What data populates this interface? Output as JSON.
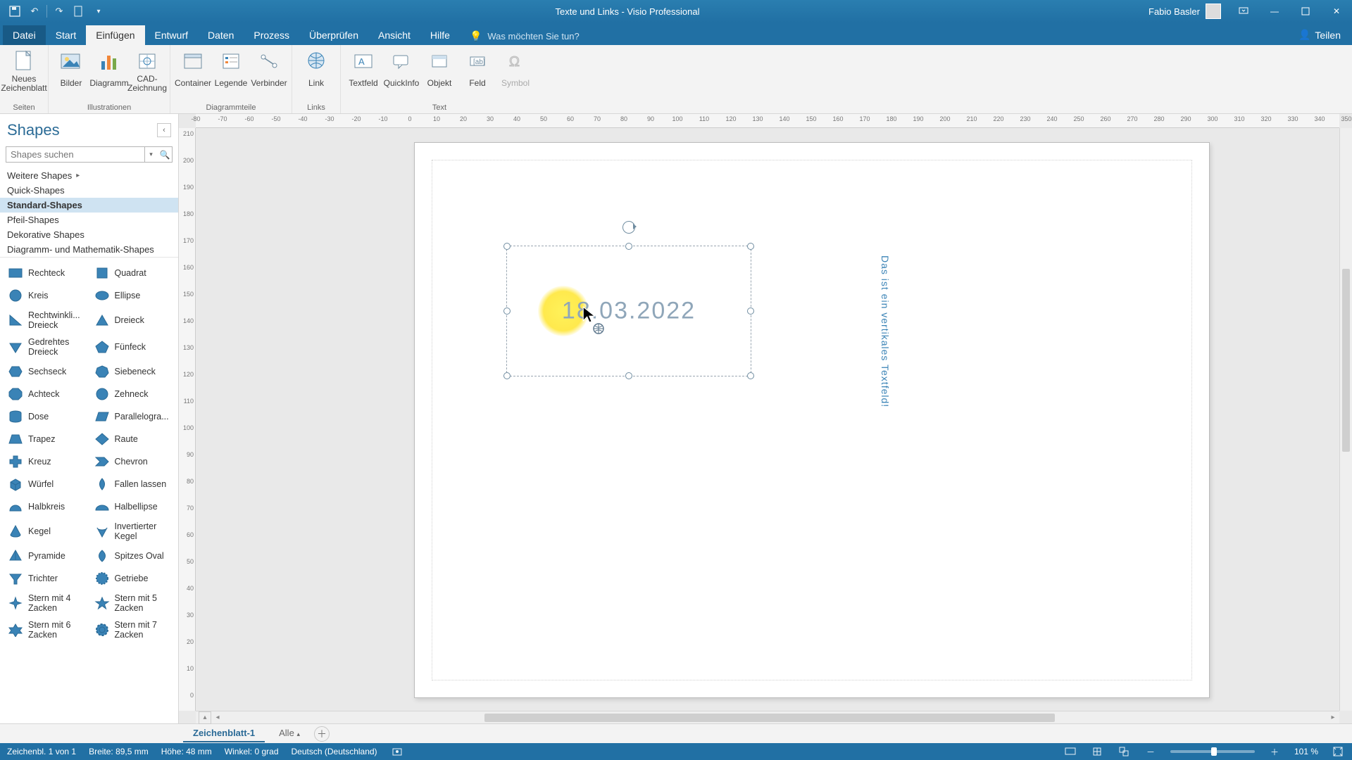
{
  "titlebar": {
    "title": "Texte und Links  -  Visio Professional",
    "user": "Fabio Basler"
  },
  "menu": {
    "tabs": [
      "Datei",
      "Start",
      "Einfügen",
      "Entwurf",
      "Daten",
      "Prozess",
      "Überprüfen",
      "Ansicht",
      "Hilfe"
    ],
    "active_index": 2,
    "tellme": "Was möchten Sie tun?",
    "share": "Teilen"
  },
  "ribbon": {
    "groups": [
      {
        "label": "Seiten",
        "items": [
          {
            "key": "new-page",
            "label": "Neues\nZeichenblatt"
          }
        ]
      },
      {
        "label": "Illustrationen",
        "items": [
          {
            "key": "pictures",
            "label": "Bilder"
          },
          {
            "key": "chart",
            "label": "Diagramm"
          },
          {
            "key": "cad",
            "label": "CAD-\nZeichnung"
          }
        ]
      },
      {
        "label": "Diagrammteile",
        "items": [
          {
            "key": "container",
            "label": "Container"
          },
          {
            "key": "legend",
            "label": "Legende"
          },
          {
            "key": "connector",
            "label": "Verbinder"
          }
        ]
      },
      {
        "label": "Links",
        "items": [
          {
            "key": "link",
            "label": "Link"
          }
        ]
      },
      {
        "label": "Text",
        "items": [
          {
            "key": "textbox",
            "label": "Textfeld"
          },
          {
            "key": "quickinfo",
            "label": "QuickInfo"
          },
          {
            "key": "object",
            "label": "Objekt"
          },
          {
            "key": "field",
            "label": "Feld"
          },
          {
            "key": "symbol",
            "label": "Symbol",
            "disabled": true
          }
        ]
      }
    ]
  },
  "shapes_pane": {
    "title": "Shapes",
    "search_placeholder": "Shapes suchen",
    "more": "Weitere Shapes",
    "categories": [
      "Quick-Shapes",
      "Standard-Shapes",
      "Pfeil-Shapes",
      "Dekorative Shapes",
      "Diagramm- und Mathematik-Shapes"
    ],
    "selected_category_index": 1,
    "shapes": [
      [
        "Rechteck",
        "Quadrat"
      ],
      [
        "Kreis",
        "Ellipse"
      ],
      [
        "Rechtwinkli... Dreieck",
        "Dreieck"
      ],
      [
        "Gedrehtes Dreieck",
        "Fünfeck"
      ],
      [
        "Sechseck",
        "Siebeneck"
      ],
      [
        "Achteck",
        "Zehneck"
      ],
      [
        "Dose",
        "Parallelogra..."
      ],
      [
        "Trapez",
        "Raute"
      ],
      [
        "Kreuz",
        "Chevron"
      ],
      [
        "Würfel",
        "Fallen lassen"
      ],
      [
        "Halbkreis",
        "Halbellipse"
      ],
      [
        "Kegel",
        "Invertierter Kegel"
      ],
      [
        "Pyramide",
        "Spitzes Oval"
      ],
      [
        "Trichter",
        "Getriebe"
      ],
      [
        "Stern mit 4 Zacken",
        "Stern mit 5 Zacken"
      ],
      [
        "Stern mit 6 Zacken",
        "Stern mit 7 Zacken"
      ]
    ]
  },
  "canvas": {
    "date_text": "18.03.2022",
    "vertical_text": "Das ist ein vertikales Textfeld!",
    "hruler_ticks": [
      "-80",
      "-70",
      "-60",
      "-50",
      "-40",
      "-30",
      "-20",
      "-10",
      "0",
      "10",
      "20",
      "30",
      "40",
      "50",
      "60",
      "70",
      "80",
      "90",
      "100",
      "110",
      "120",
      "130",
      "140",
      "150",
      "160",
      "170",
      "180",
      "190",
      "200",
      "210",
      "220",
      "230",
      "240",
      "250",
      "260",
      "270",
      "280",
      "290",
      "300",
      "310",
      "320",
      "330",
      "340",
      "350"
    ],
    "vruler_ticks": [
      "210",
      "200",
      "190",
      "180",
      "170",
      "160",
      "150",
      "140",
      "130",
      "120",
      "110",
      "100",
      "90",
      "80",
      "70",
      "60",
      "50",
      "40",
      "30",
      "20",
      "10",
      "0"
    ]
  },
  "pagetabs": {
    "active": "Zeichenblatt-1",
    "all": "Alle"
  },
  "status": {
    "page_indicator": "Zeichenbl. 1 von 1",
    "width": "Breite: 89,5 mm",
    "height": "Höhe: 48 mm",
    "angle": "Winkel: 0 grad",
    "language": "Deutsch (Deutschland)",
    "zoom": "101 %"
  }
}
